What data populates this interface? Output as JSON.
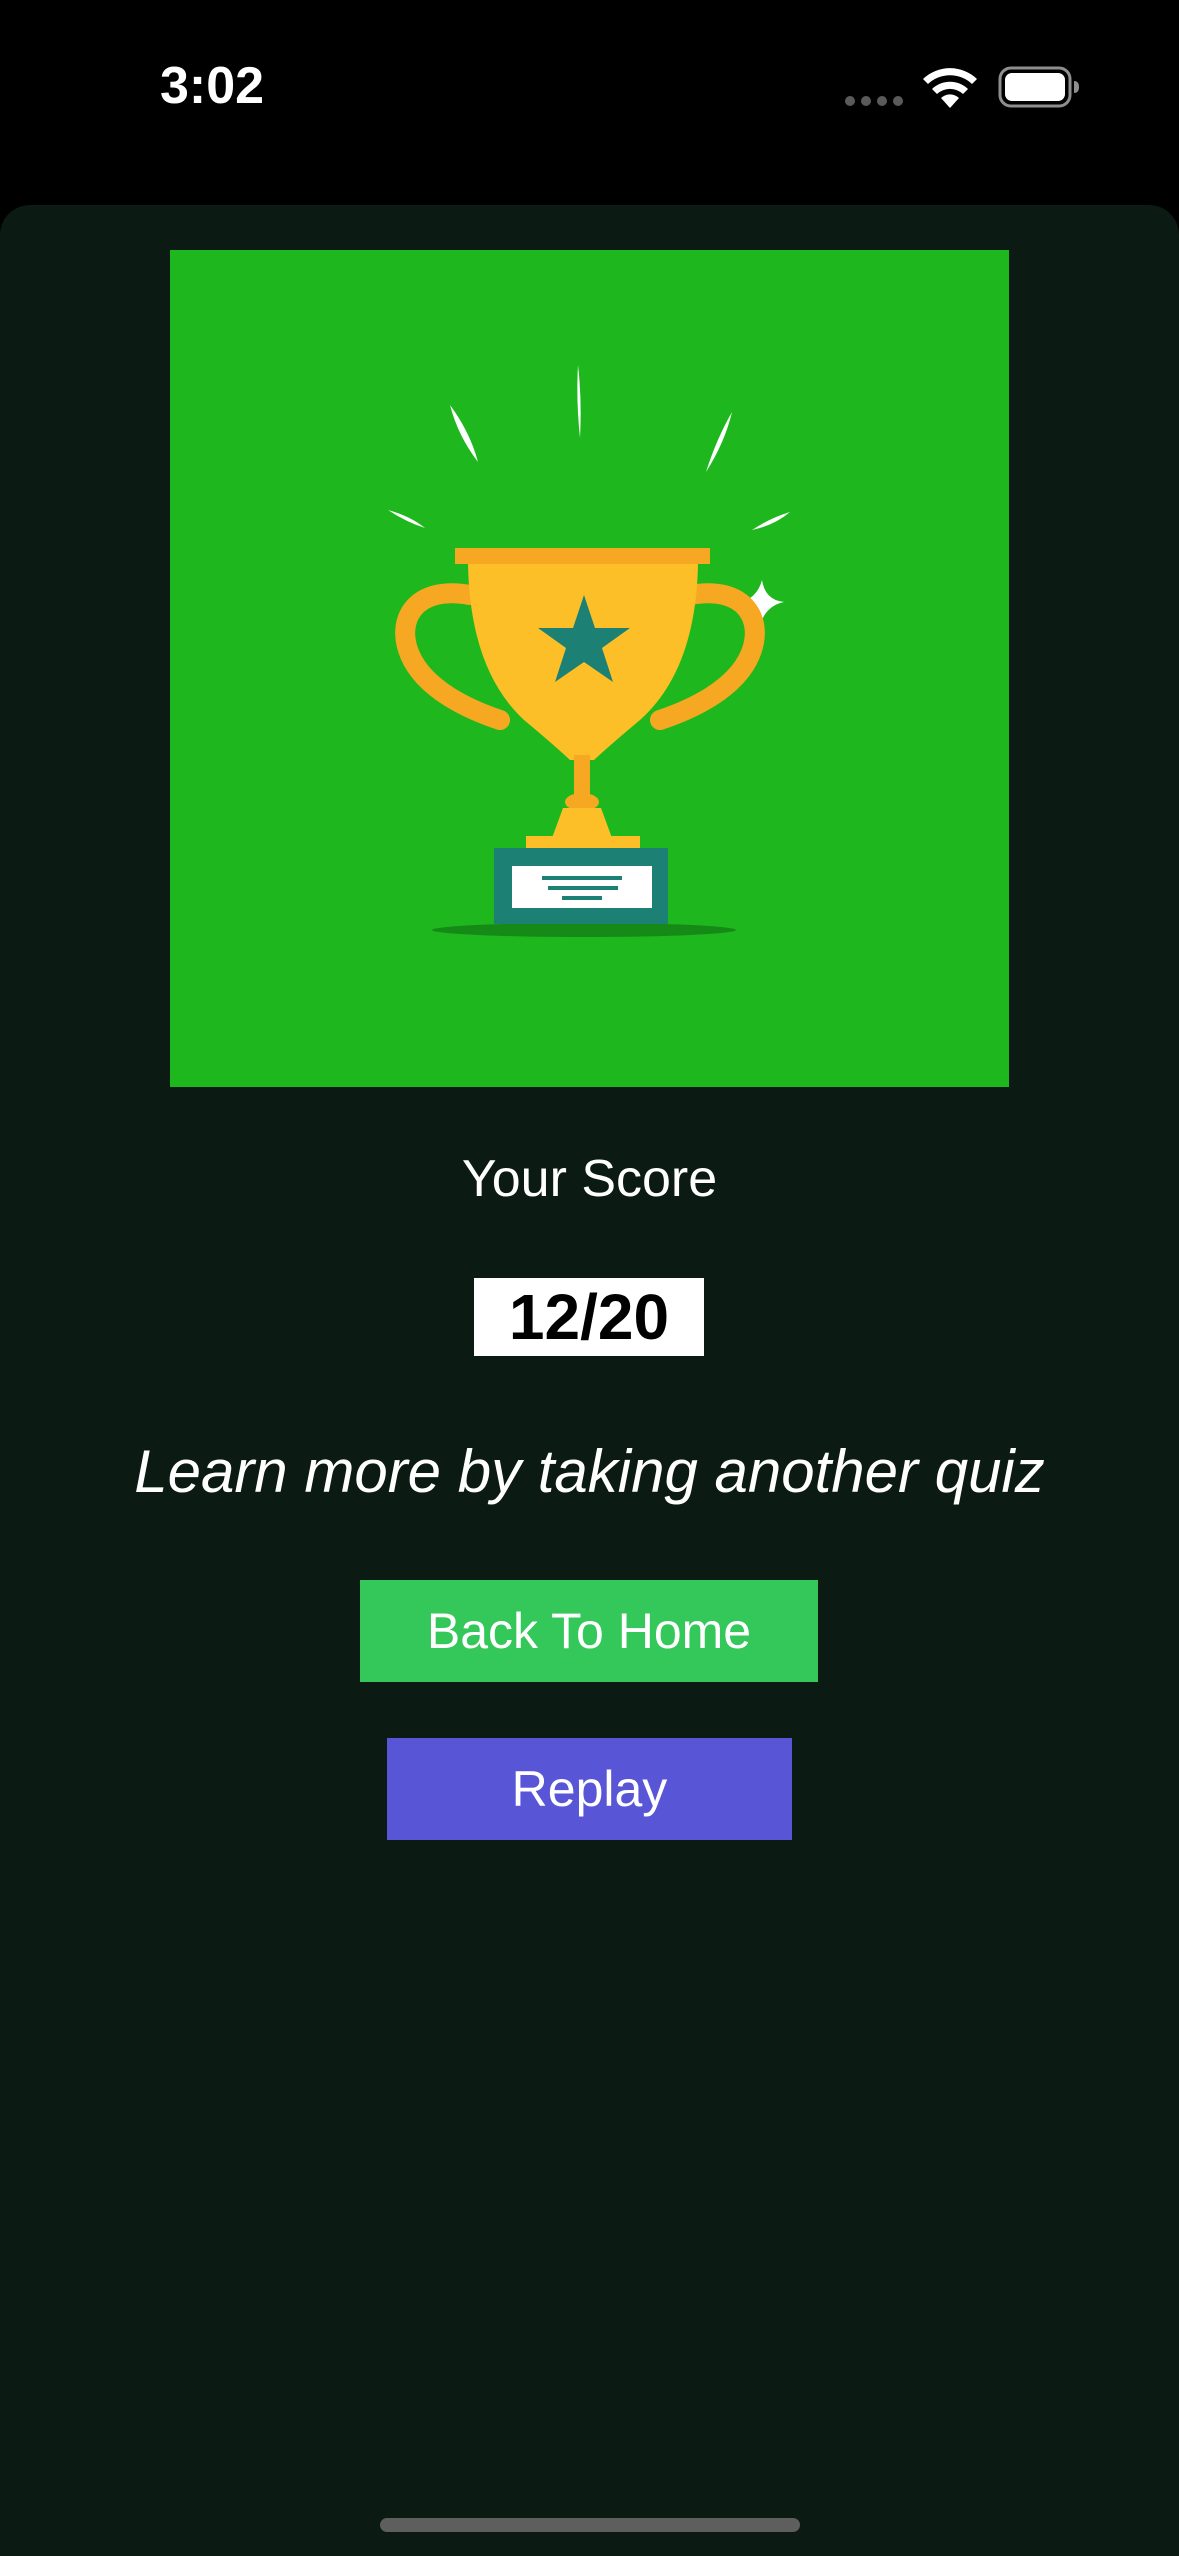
{
  "status_bar": {
    "time": "3:02",
    "icons": [
      "cellular-signal-icon",
      "wifi-icon",
      "battery-icon"
    ]
  },
  "hero": {
    "icon": "trophy-icon",
    "colors": {
      "background": "#1eb71e",
      "cup": "#fcbf28",
      "handles": "#f7a823",
      "star": "#1d8075",
      "plaque_base": "#1d8075"
    }
  },
  "result": {
    "label": "Your Score",
    "score": "12/20",
    "message": "Learn more by taking another quiz"
  },
  "actions": {
    "home_label": "Back To Home",
    "replay_label": "Replay"
  },
  "colors": {
    "screen_background": "#0b1a12",
    "home_button": "#34c759",
    "replay_button": "#5856d6",
    "score_box": "#ffffff"
  }
}
